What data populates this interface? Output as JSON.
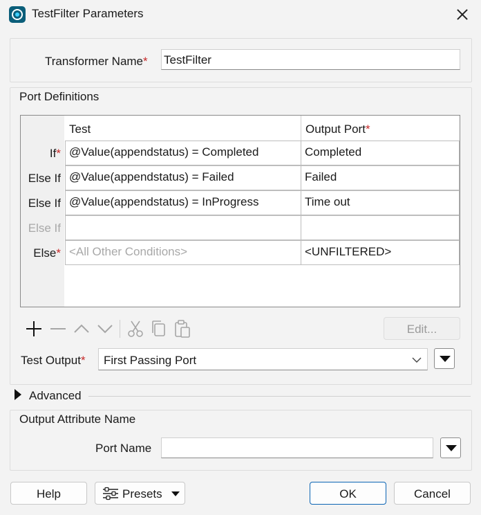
{
  "window": {
    "title": "TestFilter Parameters"
  },
  "transformer": {
    "label": "Transformer Name",
    "value": "TestFilter"
  },
  "port_definitions": {
    "title": "Port Definitions",
    "headers": {
      "test": "Test",
      "output": "Output Port"
    },
    "rows": [
      {
        "label": "If",
        "required": true,
        "test": "@Value(appendstatus) = Completed",
        "output": "Completed"
      },
      {
        "label": "Else If",
        "required": false,
        "test": "@Value(appendstatus) = Failed",
        "output": "Failed"
      },
      {
        "label": "Else If",
        "required": false,
        "test": "@Value(appendstatus) = InProgress",
        "output": "Time out"
      },
      {
        "label": "Else If",
        "required": false,
        "test": "",
        "output": "",
        "placeholder_row": true
      },
      {
        "label": "Else",
        "required": true,
        "test": "<All Other Conditions>",
        "output": "<UNFILTERED>"
      }
    ],
    "edit_label": "Edit..."
  },
  "test_output": {
    "label": "Test Output",
    "value": "First Passing Port"
  },
  "advanced": {
    "label": "Advanced"
  },
  "output_attribute": {
    "title": "Output Attribute Name",
    "port_label": "Port Name",
    "port_value": ""
  },
  "footer": {
    "help": "Help",
    "presets": "Presets",
    "ok": "OK",
    "cancel": "Cancel"
  },
  "colors": {
    "required_star": "#c62828",
    "primary_border": "#0a64b4",
    "app_icon": "#0b5e7a"
  },
  "icons": [
    "app-icon",
    "close-icon",
    "add-icon",
    "remove-icon",
    "move-up-icon",
    "move-down-icon",
    "cut-icon",
    "copy-icon",
    "paste-icon",
    "expand-triangle-icon",
    "presets-sliders-icon",
    "dropdown-arrow-icon"
  ]
}
